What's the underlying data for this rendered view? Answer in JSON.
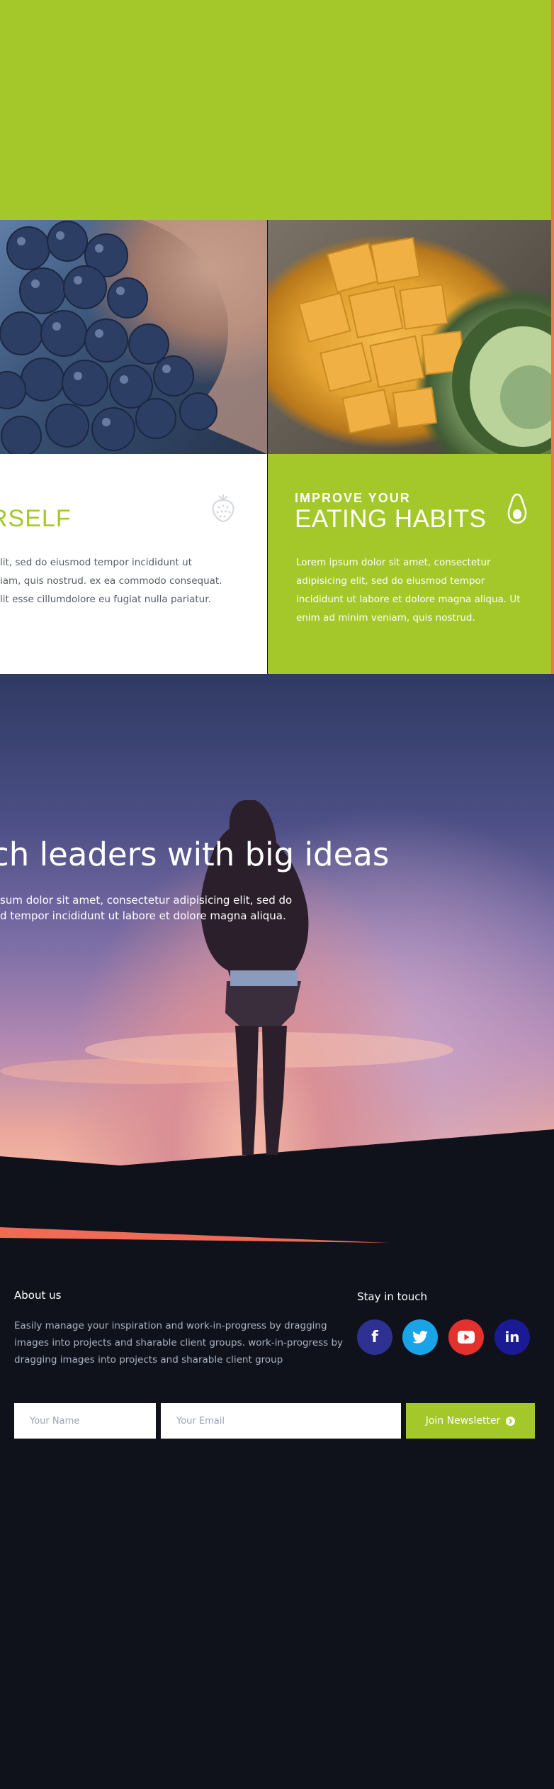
{
  "cards": {
    "left": {
      "heading": "RSELF",
      "text": "lit, sed do eiusmod tempor incididunt ut\niam, quis nostrud. ex ea commodo consequat.\nlit esse cillumdolore eu fugiat nulla pariatur.",
      "icon": "strawberry-icon"
    },
    "right": {
      "kicker": "IMPROVE YOUR",
      "heading": "EATING HABITS",
      "text": "Lorem ipsum dolor sit amet, consectetur adipisicing elit, sed do eiusmod tempor incididunt ut labore et dolore magna aliqua. Ut enim ad minim veniam, quis nostrud.",
      "icon": "avocado-icon"
    }
  },
  "hero": {
    "title": "ch leaders with big ideas",
    "subtitle": "sum dolor sit amet, consectetur adipisicing elit, sed do\nd tempor incididunt ut labore et dolore magna aliqua."
  },
  "footer": {
    "about_heading": "About us",
    "about_text": "Easily manage your inspiration and work-in-progress by dragging images into projects and sharable client groups. work-in-progress by dragging images into projects and sharable client group",
    "social_heading": "Stay in touch",
    "social": [
      {
        "name": "facebook",
        "glyph": "f",
        "color": "#2e3192"
      },
      {
        "name": "twitter",
        "glyph": "t",
        "color": "#1aa4e8"
      },
      {
        "name": "youtube",
        "glyph": "▶",
        "color": "#e3312e"
      },
      {
        "name": "linkedin",
        "glyph": "in",
        "color": "#1a1b94"
      }
    ],
    "newsletter": {
      "name_placeholder": "Your Name",
      "email_placeholder": "Your Email",
      "button_label": "Join Newsletter"
    }
  },
  "colors": {
    "accent_green": "#a4c829",
    "accent_orange": "#f06b55",
    "footer_bg": "#0f121b"
  }
}
